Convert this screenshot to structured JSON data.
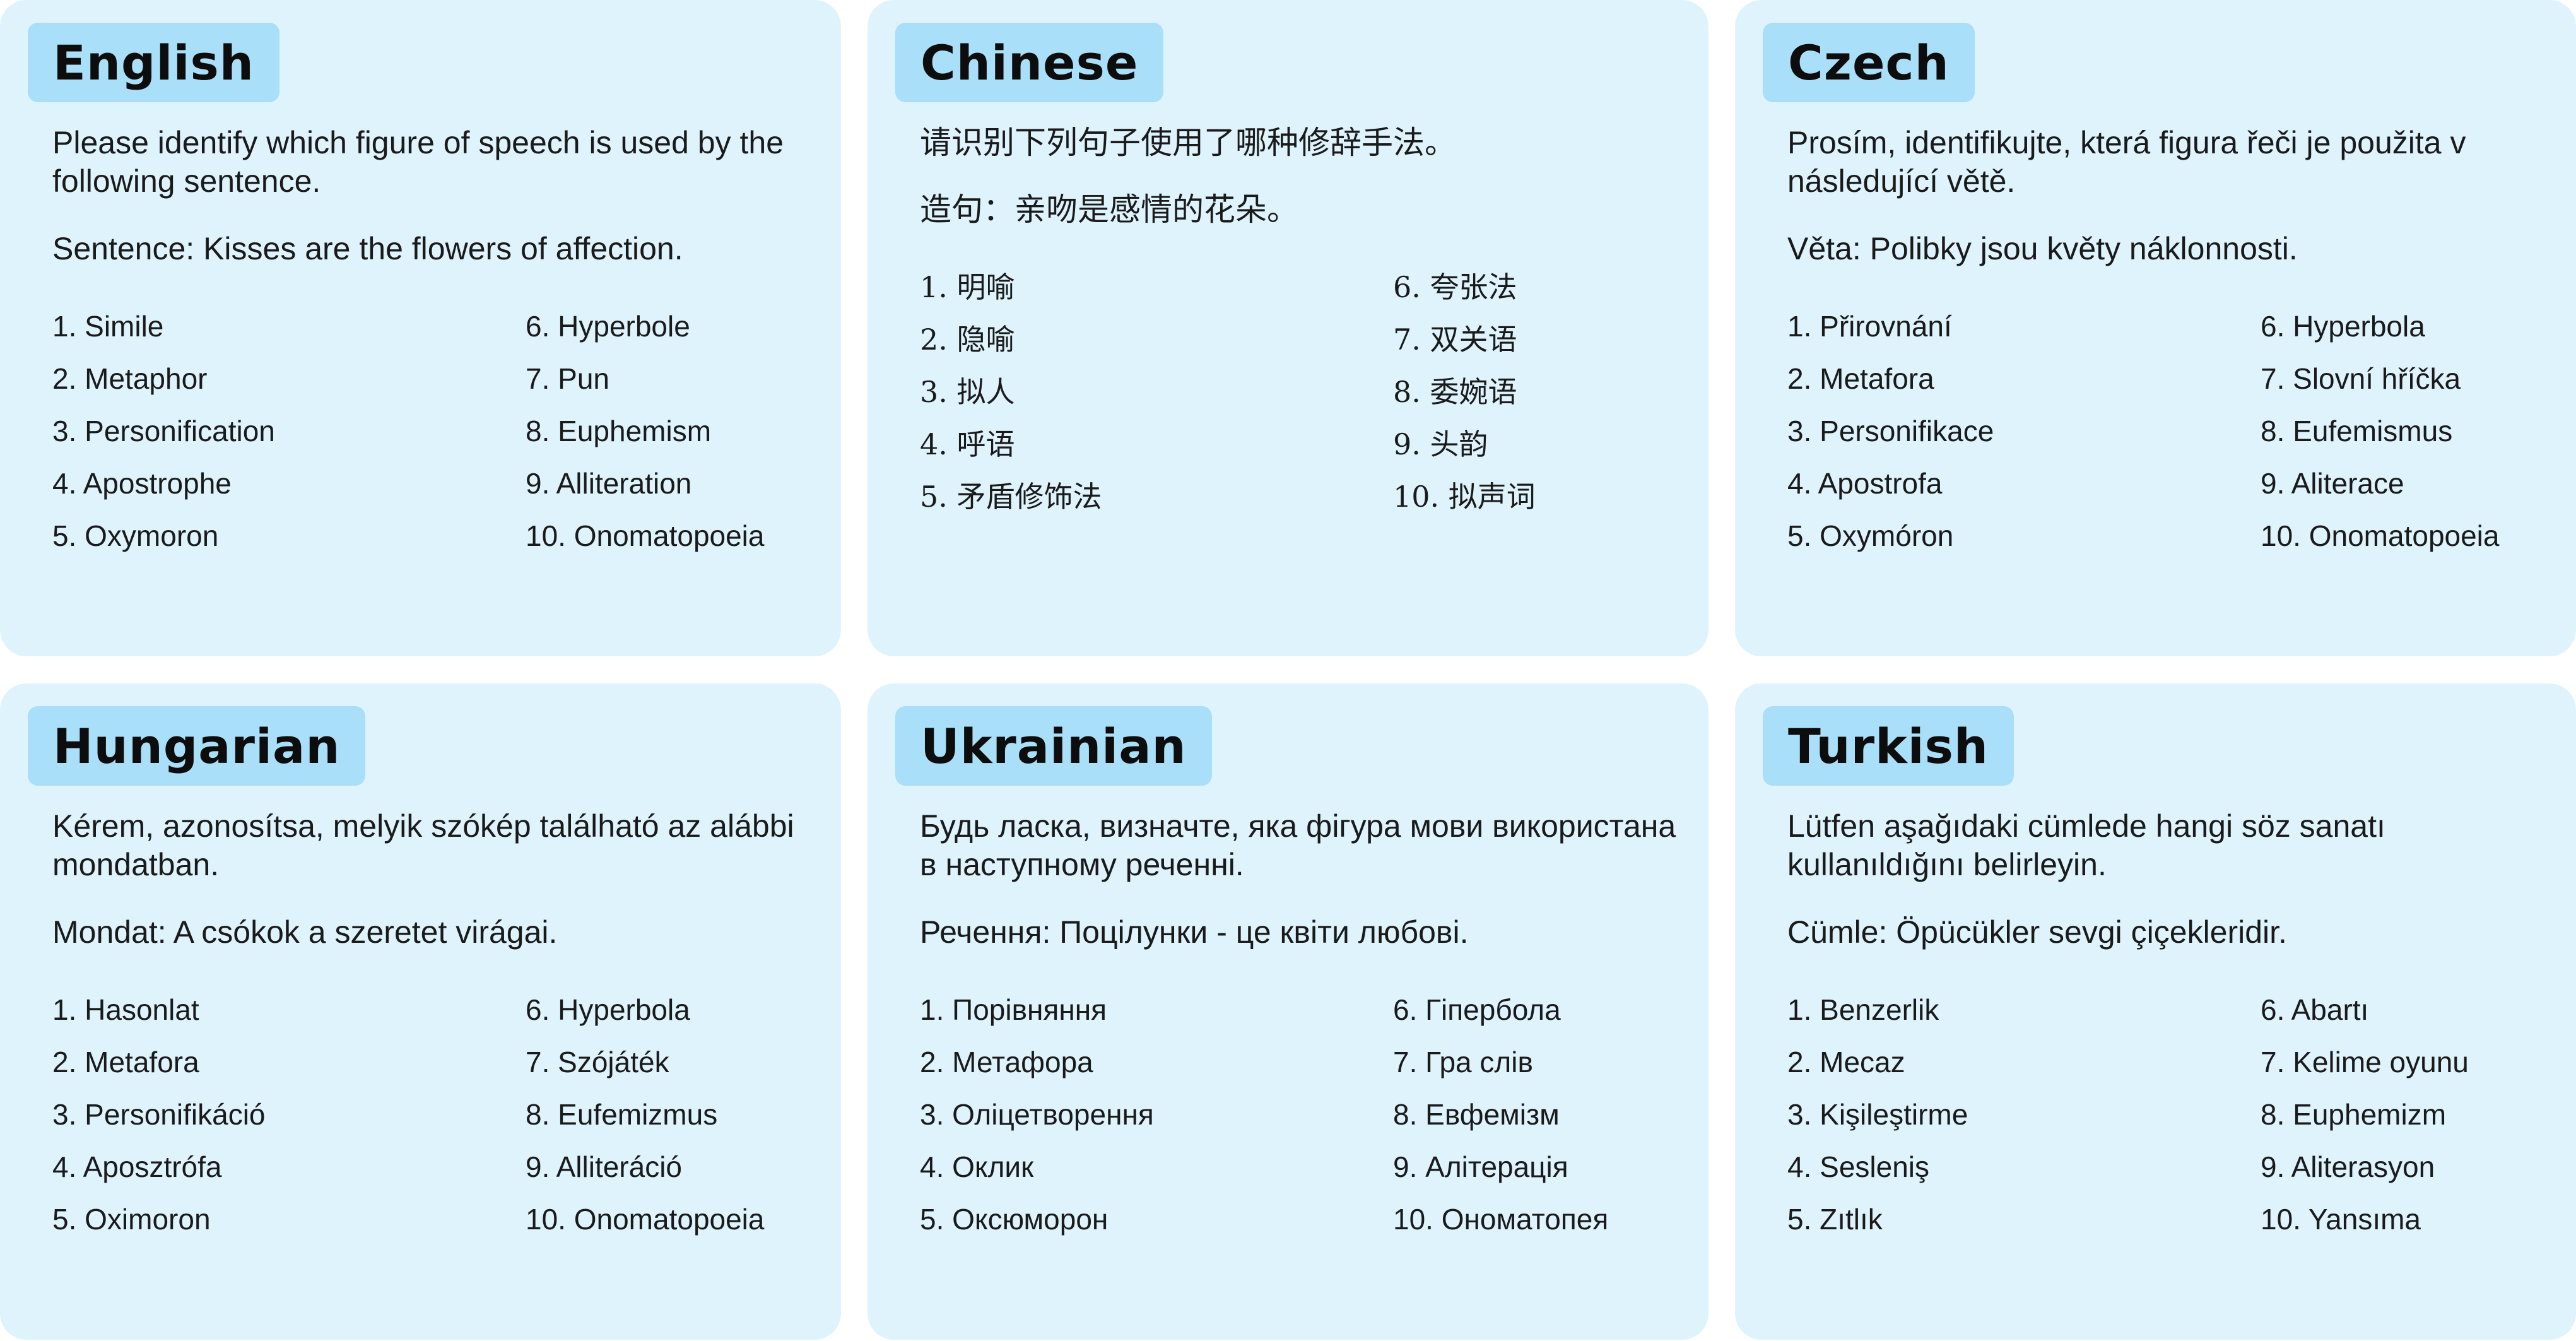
{
  "cards": [
    {
      "title": "English",
      "prompt": "Please identify which figure of speech is used by the following sentence.",
      "sentence": "Sentence: Kisses are the flowers of affection.",
      "options": [
        "1. Simile",
        "2. Metaphor",
        "3. Personification",
        "4. Apostrophe",
        "5. Oxymoron",
        "6. Hyperbole",
        "7. Pun",
        "8. Euphemism",
        "9. Alliteration",
        "10. Onomatopoeia"
      ]
    },
    {
      "title": "Chinese",
      "prompt": "请识别下列句子使用了哪种修辞手法。",
      "sentence": "造句：亲吻是感情的花朵。",
      "options": [
        "1. 明喻",
        "2. 隐喻",
        "3. 拟人",
        "4. 呼语",
        "5. 矛盾修饰法",
        "6. 夸张法",
        "7. 双关语",
        "8. 委婉语",
        "9. 头韵",
        "10. 拟声词"
      ]
    },
    {
      "title": "Czech",
      "prompt": "Prosím, identifikujte, která figura řeči je použita v následující větě.",
      "sentence": "Věta: Polibky jsou květy náklonnosti.",
      "options": [
        "1. Přirovnání",
        "2. Metafora",
        "3. Personifikace",
        "4. Apostrofa",
        "5. Oxymóron",
        "6. Hyperbola",
        "7. Slovní hříčka",
        "8. Eufemismus",
        "9. Aliterace",
        "10. Onomatopoeia"
      ]
    },
    {
      "title": "Hungarian",
      "prompt": "Kérem, azonosítsa, melyik szókép található az alábbi mondatban.",
      "sentence": "Mondat: A csókok a szeretet virágai.",
      "options": [
        "1. Hasonlat",
        "2. Metafora",
        "3. Personifikáció",
        "4. Aposztrófa",
        "5. Oximoron",
        "6. Hyperbola",
        "7. Szójáték",
        "8. Eufemizmus",
        "9. Alliteráció",
        "10. Onomatopoeia"
      ]
    },
    {
      "title": "Ukrainian",
      "prompt": "Будь ласка, визначте, яка фігура мови використана в наступному реченні.",
      "sentence": "Речення: Поцілунки - це квіти любові.",
      "options": [
        "1. Порівняння",
        "2. Метафора",
        "3. Оліцетворення",
        "4. Оклик",
        "5. Оксюморон",
        "6. Гіпербола",
        "7. Гра слів",
        "8. Евфемізм",
        "9. Алітерація",
        "10. Ономатопея"
      ]
    },
    {
      "title": "Turkish",
      "prompt": "Lütfen aşağıdaki cümlede hangi söz sanatı kullanıldığını belirleyin.",
      "sentence": "Cümle: Öpücükler sevgi çiçekleridir.",
      "options": [
        "1. Benzerlik",
        "2. Mecaz",
        "3. Kişileştirme",
        "4. Sesleniş",
        "5. Zıtlık",
        "6. Abartı",
        "7. Kelime oyunu",
        "8. Euphemizm",
        "9. Aliterasyon",
        "10. Yansıma"
      ]
    }
  ],
  "colors": {
    "card_background": "#dff3fd",
    "title_background": "#a9dff9",
    "text": "#1a1a1a"
  }
}
